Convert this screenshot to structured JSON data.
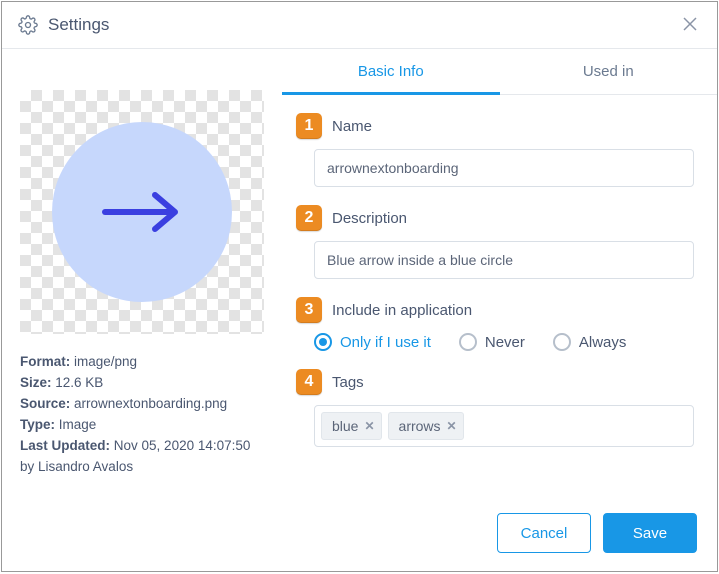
{
  "dialog": {
    "title": "Settings"
  },
  "tabs": {
    "basic": "Basic Info",
    "used_in": "Used in"
  },
  "markers": {
    "name": "1",
    "description": "2",
    "include": "3",
    "tags": "4"
  },
  "labels": {
    "name": "Name",
    "description": "Description",
    "include": "Include in application",
    "tags": "Tags"
  },
  "fields": {
    "name_value": "arrownextonboarding",
    "description_value": "Blue arrow inside a blue circle"
  },
  "radios": {
    "only_if": "Only if I use it",
    "never": "Never",
    "always": "Always"
  },
  "tags": [
    "blue",
    "arrows"
  ],
  "meta": {
    "format_label": "Format:",
    "format_value": "image/png",
    "size_label": "Size:",
    "size_value": "12.6 KB",
    "source_label": "Source:",
    "source_value": "arrownextonboarding.png",
    "type_label": "Type:",
    "type_value": "Image",
    "updated_label": "Last Updated:",
    "updated_value": "Nov 05, 2020 14:07:50",
    "by_line": "by Lisandro Avalos"
  },
  "buttons": {
    "cancel": "Cancel",
    "save": "Save"
  }
}
